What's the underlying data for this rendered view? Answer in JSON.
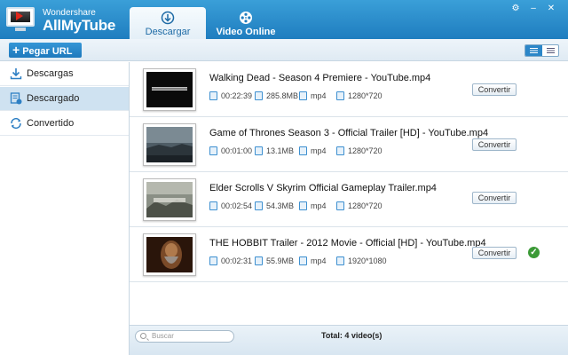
{
  "app": {
    "brand_small": "Wondershare",
    "brand_big": "AllMyTube"
  },
  "tabs": [
    {
      "label": "Descargar",
      "icon": "download-circle-icon",
      "active": true
    },
    {
      "label": "Video Online",
      "icon": "film-reel-icon",
      "active": false
    }
  ],
  "window_controls": [
    {
      "icon": "settings-icon",
      "glyph": "⚙"
    },
    {
      "icon": "minimize-icon",
      "glyph": "–"
    },
    {
      "icon": "close-icon",
      "glyph": "✕"
    }
  ],
  "toolbar": {
    "paste_url_label": "Pegar URL",
    "view_mode": "detailed-list"
  },
  "sidebar": {
    "items": [
      {
        "label": "Descargas",
        "icon": "download-icon",
        "active": false
      },
      {
        "label": "Descargado",
        "icon": "downloaded-icon",
        "active": true
      },
      {
        "label": "Convertido",
        "icon": "converted-icon",
        "active": false
      }
    ]
  },
  "videos": [
    {
      "title": "Walking Dead - Season 4 Premiere - YouTube.mp4",
      "duration": "00:22:39",
      "size": "285.8MB",
      "format": "mp4",
      "resolution": "1280*720",
      "convert_label": "Convertir",
      "converted": false
    },
    {
      "title": "Game of Thrones Season 3 - Official Trailer [HD] - YouTube.mp4",
      "duration": "00:01:00",
      "size": "13.1MB",
      "format": "mp4",
      "resolution": "1280*720",
      "convert_label": "Convertir",
      "converted": false
    },
    {
      "title": "Elder Scrolls V Skyrim Official Gameplay Trailer.mp4",
      "duration": "00:02:54",
      "size": "54.3MB",
      "format": "mp4",
      "resolution": "1280*720",
      "convert_label": "Convertir",
      "converted": false
    },
    {
      "title": "THE HOBBIT Trailer - 2012 Movie - Official [HD] - YouTube.mp4",
      "duration": "00:02:31",
      "size": "55.9MB",
      "format": "mp4",
      "resolution": "1920*1080",
      "convert_label": "Convertir",
      "converted": true
    }
  ],
  "statusbar": {
    "search_placeholder": "Buscar",
    "total": "Total: 4 video(s)"
  },
  "colors": {
    "header_top": "#3a9fd8",
    "header_bottom": "#1f7dbf",
    "accent": "#1e79bd",
    "selected_row": "#cfe2f1",
    "check_green": "#3b9a36"
  }
}
